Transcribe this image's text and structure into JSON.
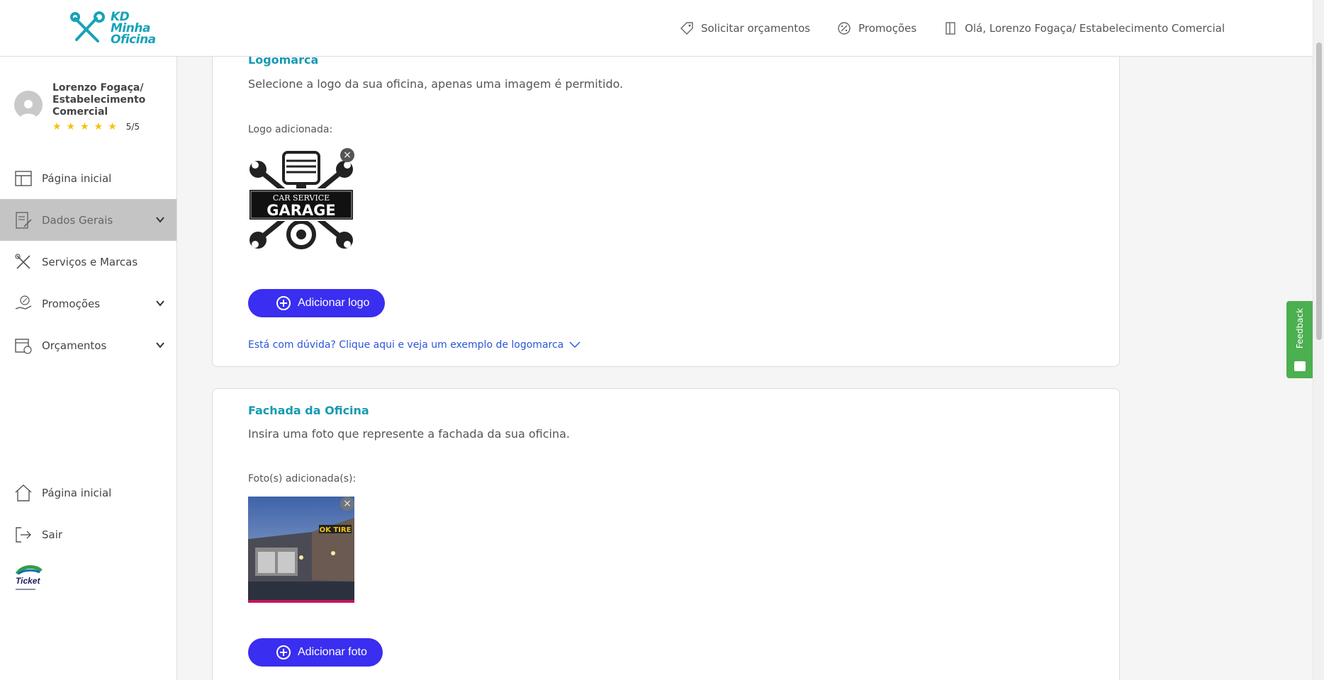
{
  "header": {
    "brand_line1": "KD",
    "brand_line2": "Minha",
    "brand_line3": "Oficina",
    "nav": [
      {
        "label": "Solicitar orçamentos",
        "icon": "tag-icon"
      },
      {
        "label": "Promoções",
        "icon": "percent-badge-icon"
      },
      {
        "label": "Olá, Lorenzo Fogaça/ Estabelecimento Comercial",
        "icon": "door-icon"
      }
    ]
  },
  "sidebar": {
    "user_name": "Lorenzo Fogaça/ Estabelecimento Comercial",
    "stars": "★★★★★",
    "rating": "5/5",
    "items": [
      {
        "label": "Página inicial",
        "icon": "layout-icon"
      },
      {
        "label": "Dados Gerais",
        "icon": "document-edit-icon"
      },
      {
        "label": "Serviços e Marcas",
        "icon": "tools-icon"
      },
      {
        "label": "Promoções",
        "icon": "hand-percent-icon"
      },
      {
        "label": "Orçamentos",
        "icon": "calendar-clock-icon"
      }
    ],
    "bottom_items": [
      {
        "label": "Página inicial",
        "icon": "home-icon"
      },
      {
        "label": "Sair",
        "icon": "logout-icon"
      }
    ],
    "partner_logo_text": "Ticket"
  },
  "logo_section": {
    "title": "Logomarca",
    "description": "Selecione a logo da sua oficina, apenas uma imagem é permitido.",
    "added_label": "Logo adicionada:",
    "logo_line1": "CAR SERVICE",
    "logo_line2": "GARAGE",
    "add_button": "Adicionar logo",
    "help_link": "Está com dúvida? Clique aqui e veja um exemplo de logomarca"
  },
  "facade_section": {
    "title": "Fachada da Oficina",
    "description": "Insira uma foto que represente a fachada da sua oficina.",
    "added_label": "Foto(s) adicionada(s):",
    "sign_text": "OK TIRE",
    "add_button": "Adicionar foto"
  },
  "feedback": {
    "label": "Feedback"
  },
  "colors": {
    "brand": "#17a2b8",
    "primary_button": "#3a2ef0",
    "feedback": "#4caf50",
    "active_menu": "#c4c4c4",
    "link": "#2a55d8"
  }
}
